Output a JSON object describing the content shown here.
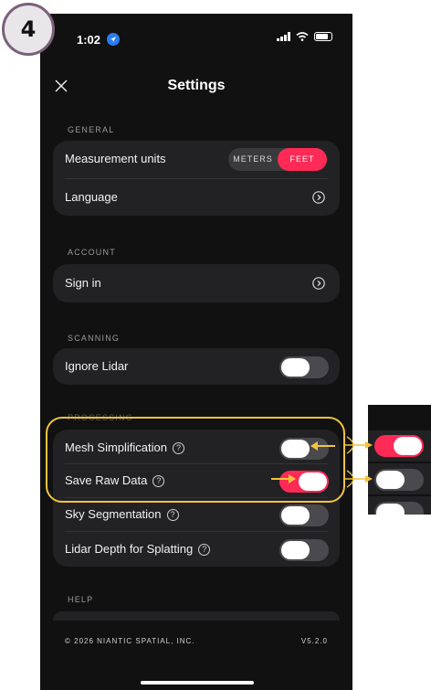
{
  "step": {
    "number": "4"
  },
  "status_bar": {
    "time": "1:02",
    "battery": "82"
  },
  "header": {
    "title": "Settings",
    "close_icon": "close-icon"
  },
  "sections": {
    "general": {
      "label": "GENERAL",
      "measurement_units": {
        "label": "Measurement units",
        "options": [
          "METERS",
          "FEET"
        ],
        "selected": "FEET"
      },
      "language": {
        "label": "Language"
      }
    },
    "account": {
      "label": "ACCOUNT",
      "sign_in": {
        "label": "Sign in"
      }
    },
    "scanning": {
      "label": "SCANNING",
      "ignore_lidar": {
        "label": "Ignore Lidar",
        "on": false
      }
    },
    "processing": {
      "label": "PROCESSING",
      "mesh_simplification": {
        "label": "Mesh Simplification",
        "on": false
      },
      "save_raw_data": {
        "label": "Save Raw Data",
        "on": true
      },
      "sky_segmentation": {
        "label": "Sky Segmentation",
        "on": false
      },
      "lidar_depth": {
        "label": "Lidar Depth for Splatting",
        "on": false
      }
    },
    "help": {
      "label": "HELP"
    }
  },
  "footer": {
    "copyright": "© 2026 NIANTIC SPATIAL, INC.",
    "version": "V5.2.0"
  },
  "colors": {
    "accent": "#ff2a55",
    "annotation": "#f2c43c",
    "background": "#111111",
    "card": "#222224"
  },
  "help_glyph": "?"
}
